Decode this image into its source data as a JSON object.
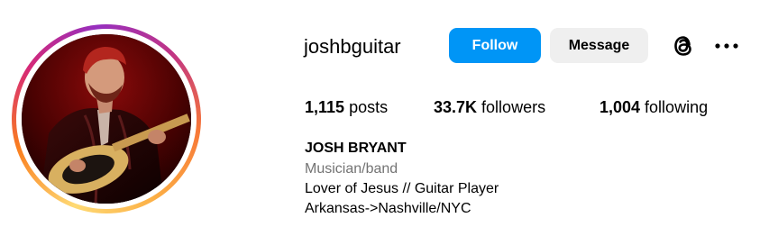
{
  "profile": {
    "username": "joshbguitar",
    "avatar_description": "profile-photo"
  },
  "actions": {
    "follow_label": "Follow",
    "message_label": "Message",
    "threads_icon": "threads-icon",
    "more_icon": "more-options-icon"
  },
  "stats": {
    "posts_count": "1,115",
    "posts_label": " posts",
    "followers_count": "33.7K",
    "followers_label": " followers",
    "following_count": "1,004",
    "following_label": " following"
  },
  "bio": {
    "full_name": "JOSH BRYANT",
    "category": "Musician/band",
    "lines": [
      "Lover of Jesus // Guitar Player",
      "Arkansas->Nashville/NYC"
    ]
  },
  "colors": {
    "follow_button": "#0095f6",
    "message_button": "#efefef",
    "category_text": "#737373"
  }
}
